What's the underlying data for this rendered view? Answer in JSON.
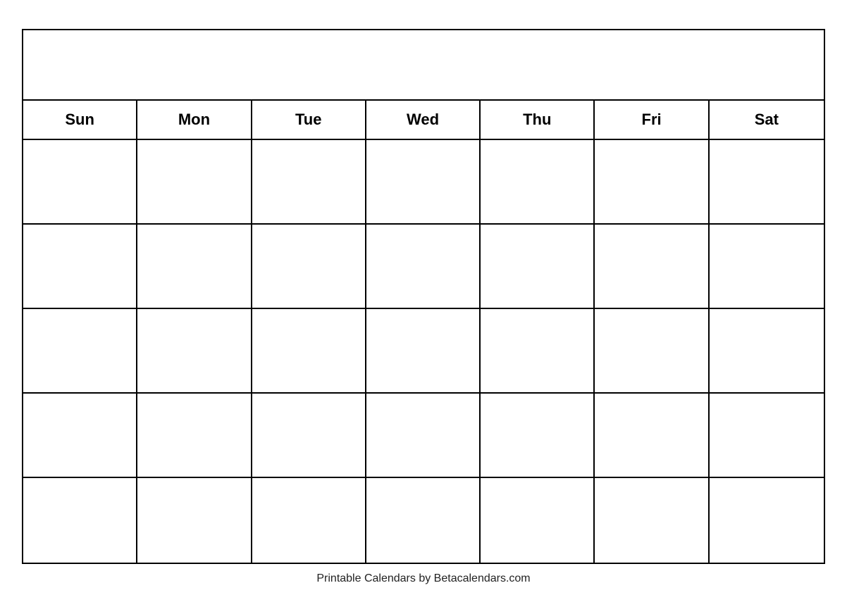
{
  "calendar": {
    "days": [
      "Sun",
      "Mon",
      "Tue",
      "Wed",
      "Thu",
      "Fri",
      "Sat"
    ],
    "rows": 5
  },
  "footer": {
    "text": "Printable Calendars by Betacalendars.com"
  }
}
